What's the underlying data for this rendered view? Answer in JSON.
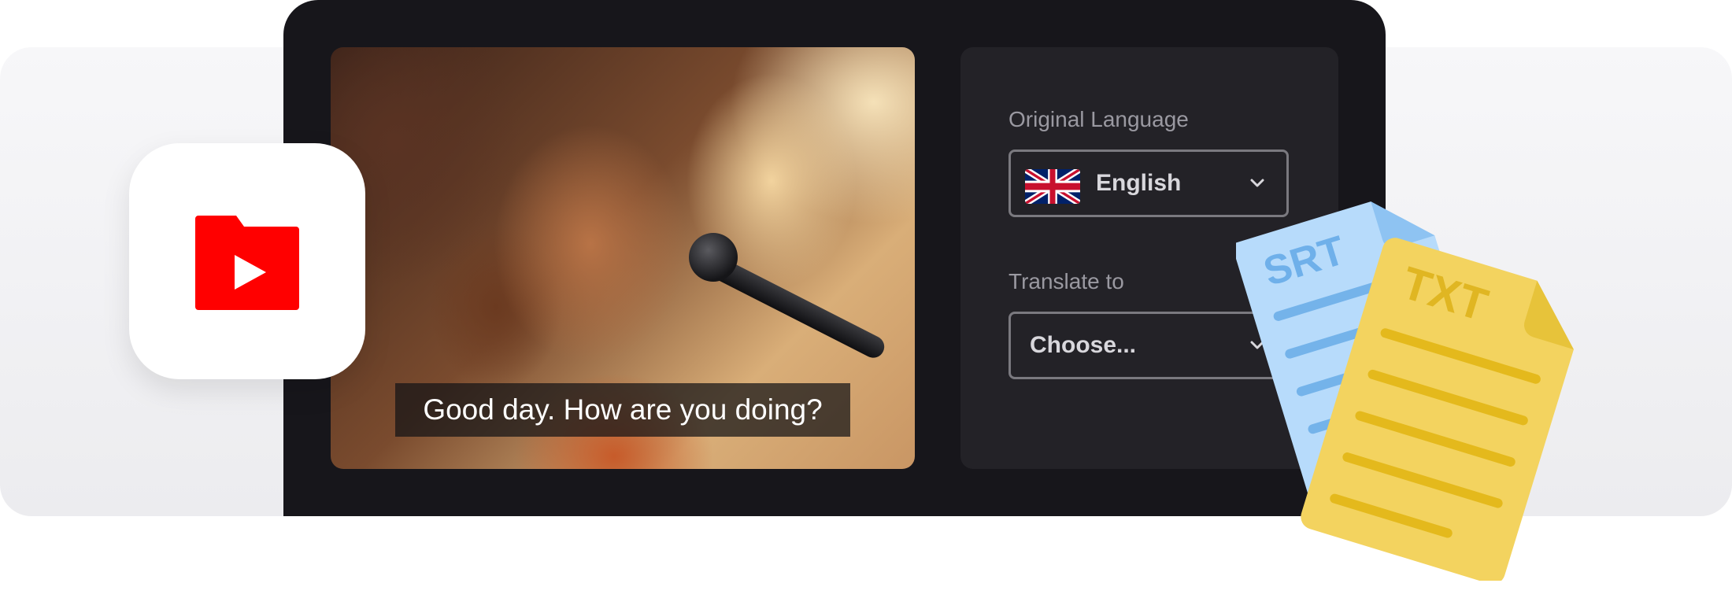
{
  "subtitle": {
    "text": "Good day. How are you doing?"
  },
  "settings": {
    "original_language_label": "Original Language",
    "original_language_value": "English",
    "translate_to_label": "Translate to",
    "translate_to_value": "Choose..."
  },
  "files": {
    "srt_label": "SRT",
    "txt_label": "TXT"
  },
  "icons": {
    "app": "youtube-folder-icon",
    "flag": "uk-flag-icon",
    "dropdown": "chevron-down-icon",
    "srt": "srt-file-icon",
    "txt": "txt-file-icon"
  },
  "colors": {
    "panel": "#17161b",
    "settings_card": "#232227",
    "youtube_red": "#ff0000",
    "srt_blue": "#b7dbfb",
    "txt_yellow": "#f3d35f"
  }
}
